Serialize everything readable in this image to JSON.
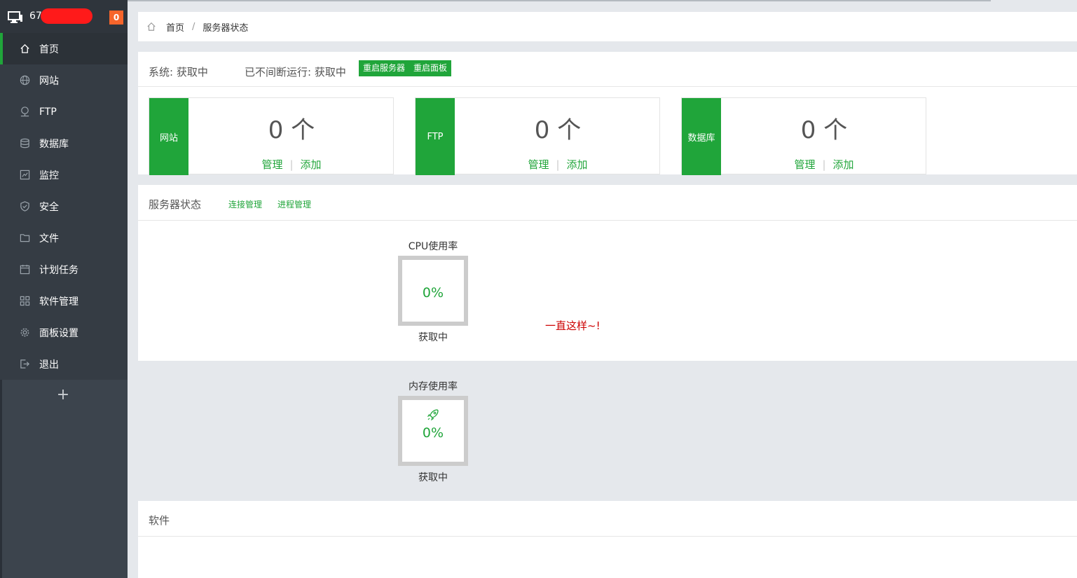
{
  "header": {
    "host": "67.",
    "message_count": "0"
  },
  "sidebar": {
    "items": [
      {
        "label": "首页",
        "icon": "home-icon",
        "active": true
      },
      {
        "label": "网站",
        "icon": "globe-icon"
      },
      {
        "label": "FTP",
        "icon": "ftp-icon"
      },
      {
        "label": "数据库",
        "icon": "database-icon"
      },
      {
        "label": "监控",
        "icon": "monitor-chart-icon"
      },
      {
        "label": "安全",
        "icon": "shield-icon"
      },
      {
        "label": "文件",
        "icon": "folder-icon"
      },
      {
        "label": "计划任务",
        "icon": "calendar-icon"
      },
      {
        "label": "软件管理",
        "icon": "grid-icon"
      },
      {
        "label": "面板设置",
        "icon": "gear-icon"
      },
      {
        "label": "退出",
        "icon": "logout-icon"
      }
    ],
    "add_label": "+"
  },
  "breadcrumb": {
    "home": "首页",
    "separator": "/",
    "current": "服务器状态"
  },
  "system": {
    "os_text": "系统: 获取中",
    "uptime_text": "已不间断运行: 获取中",
    "restart_server": "重启服务器",
    "restart_panel": "重启面板"
  },
  "stats": [
    {
      "label": "网站",
      "count": "0 个",
      "manage": "管理",
      "add": "添加"
    },
    {
      "label": "FTP",
      "count": "0 个",
      "manage": "管理",
      "add": "添加"
    },
    {
      "label": "数据库",
      "count": "0 个",
      "manage": "管理",
      "add": "添加"
    }
  ],
  "link_separator": "|",
  "server_status": {
    "title": "服务器状态",
    "connections_link": "连接管理",
    "processes_link": "进程管理",
    "cpu": {
      "label": "CPU使用率",
      "value": "0%",
      "state": "获取中"
    },
    "memory": {
      "label": "内存使用率",
      "value": "0%",
      "state": "获取中",
      "icon": "rocket-icon"
    },
    "annotation": "一直这样~!"
  },
  "software": {
    "title": "软件"
  },
  "colors": {
    "accent": "#20a53a",
    "sidebar": "#3c444d",
    "badge": "#f7652b",
    "annotation": "#cc0000"
  }
}
